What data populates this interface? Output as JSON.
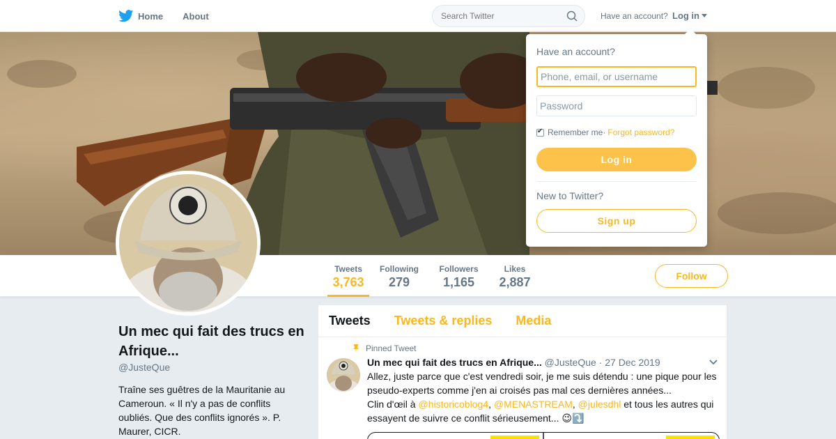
{
  "nav": {
    "home_label": "Home",
    "about_label": "About",
    "search_placeholder": "Search Twitter",
    "have_account": "Have an account?",
    "login_label": "Log in"
  },
  "profile": {
    "name": "Un mec qui fait des trucs en Afrique...",
    "handle": "@JusteQue",
    "bio": "Traîne ses guêtres de la Mauritanie au Cameroun. « Il n'y a pas de conflits oubliés. Que des conflits ignorés ». P. Maurer, CICR.",
    "follow_label": "Follow",
    "stats": [
      {
        "label": "Tweets",
        "value": "3,763"
      },
      {
        "label": "Following",
        "value": "279"
      },
      {
        "label": "Followers",
        "value": "1,165"
      },
      {
        "label": "Likes",
        "value": "2,887"
      }
    ]
  },
  "timeline": {
    "tabs": [
      "Tweets",
      "Tweets & replies",
      "Media"
    ],
    "pinned_label": "Pinned Tweet",
    "tweet": {
      "name": "Un mec qui fait des trucs en Afrique...",
      "handle": "@JusteQue",
      "separator": " · ",
      "date": "27 Dec 2019",
      "text_line1": "Allez, juste parce que c'est vendredi soir, je me suis détendu : une pique pour les pseudo-experts comme j'en ai croisés pas mal ces dernières années...",
      "text_line2_prefix": "Clin d'œil à ",
      "mention1": "@historicoblog4",
      "comma1": ", ",
      "mention2": "@MENASTREAM",
      "comma2": ", ",
      "mention3": "@julesdhl",
      "text_line2_suffix": " et tous les autres qui essayent de suivre ce conflit sérieusement... 😉⤵️"
    }
  },
  "login_dropdown": {
    "title": "Have an account?",
    "username_placeholder": "Phone, email, or username",
    "password_placeholder": "Password",
    "remember_label": "Remember me",
    "separator": " · ",
    "forgot_label": "Forgot password?",
    "login_button": "Log in",
    "new_label": "New to Twitter?",
    "signup_button": "Sign up"
  },
  "colors": {
    "accent": "#fab81e",
    "text_secondary": "#657786",
    "background": "#e6ecf0"
  },
  "icons": [
    "twitter-bird-icon",
    "search-icon",
    "chevron-down-icon",
    "pin-icon"
  ]
}
